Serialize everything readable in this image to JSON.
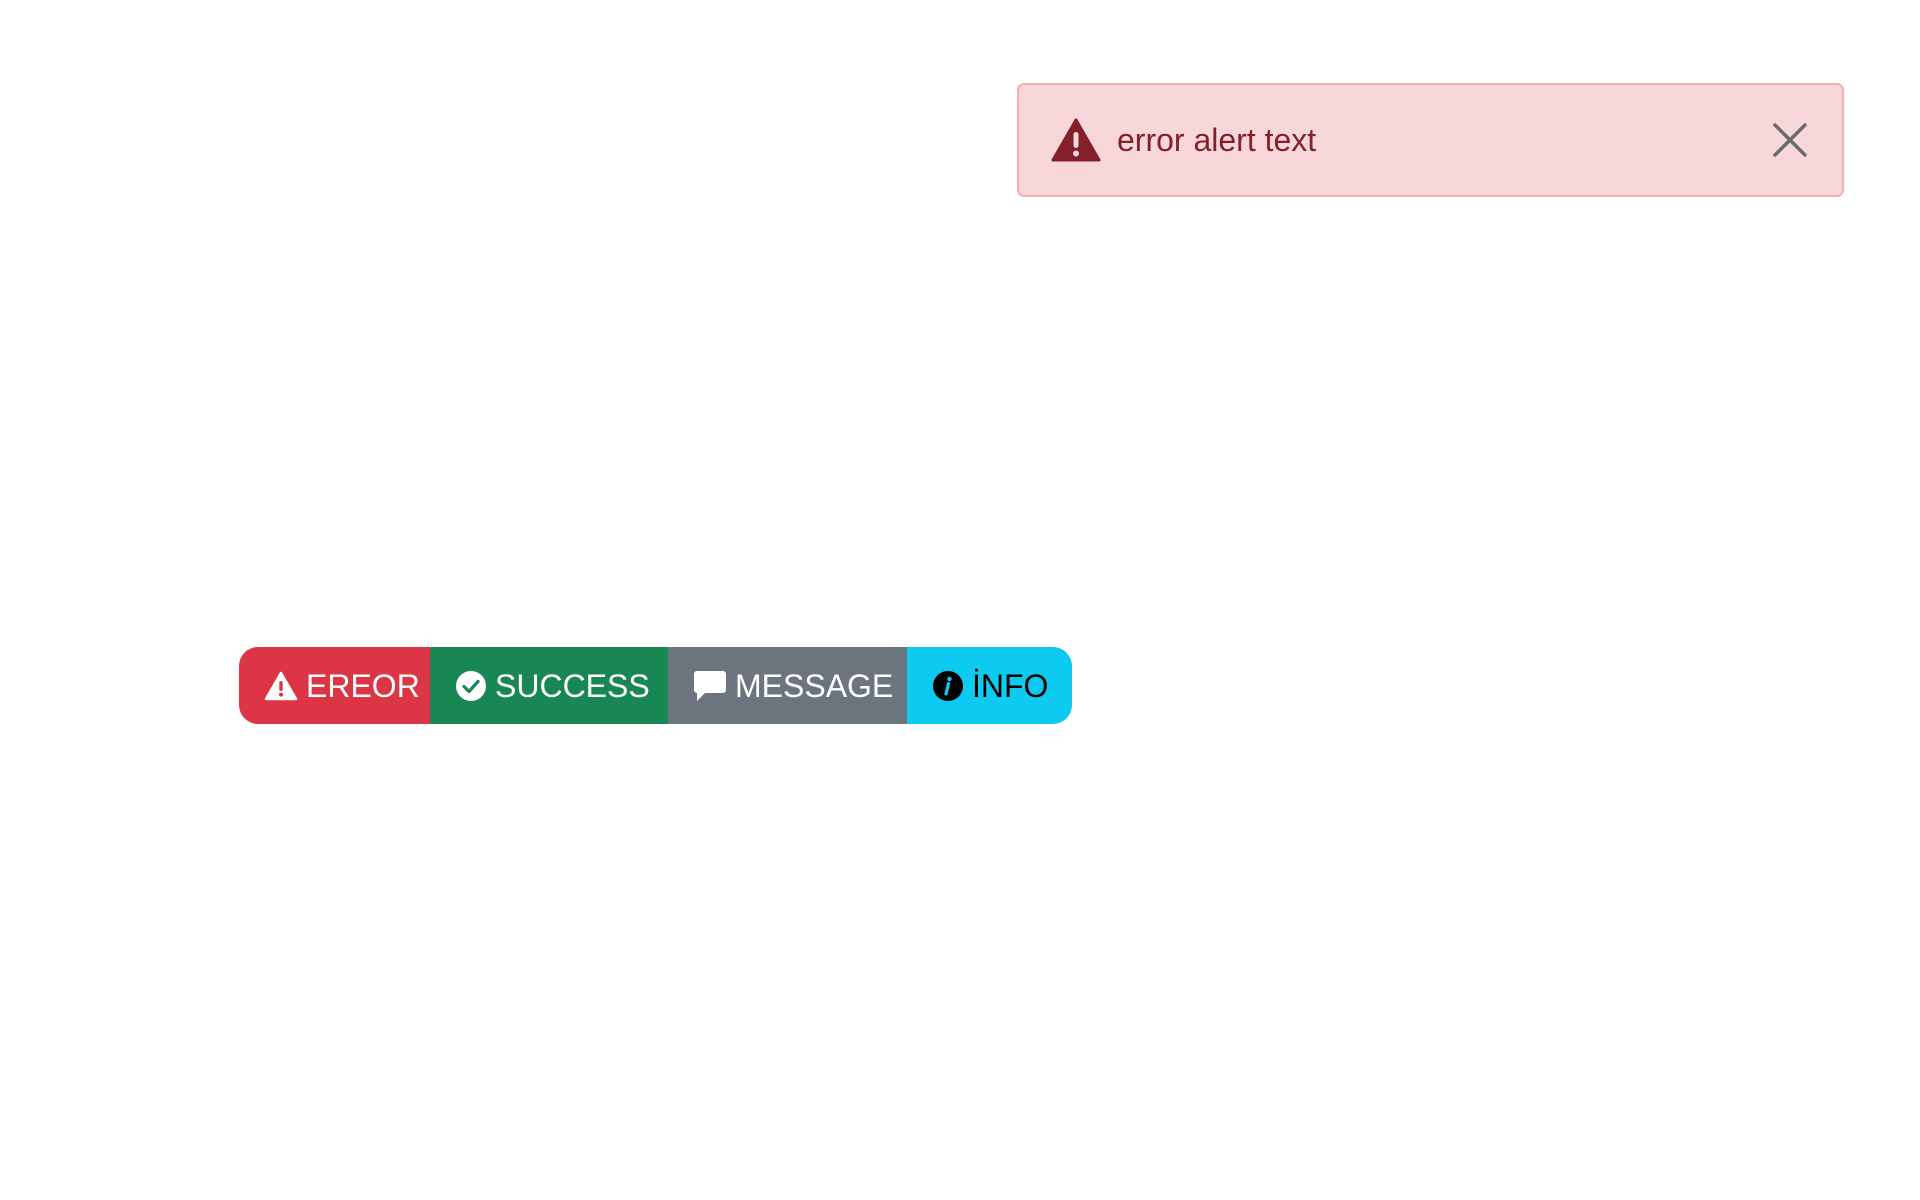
{
  "alert": {
    "text": "error alert text",
    "icon": "warning-triangle-icon",
    "close_icon": "close-icon",
    "colors": {
      "background": "#f8d7da",
      "border": "#f1aeb5",
      "text": "#842029"
    }
  },
  "buttons": [
    {
      "label": "EREOR",
      "icon": "warning-triangle-icon",
      "color": "#dc3545"
    },
    {
      "label": "SUCCESS",
      "icon": "check-circle-icon",
      "color": "#198754"
    },
    {
      "label": "MESSAGE",
      "icon": "chat-bubble-icon",
      "color": "#6c757d"
    },
    {
      "label": "İNFO",
      "icon": "info-circle-icon",
      "color": "#0dcaf0"
    }
  ]
}
